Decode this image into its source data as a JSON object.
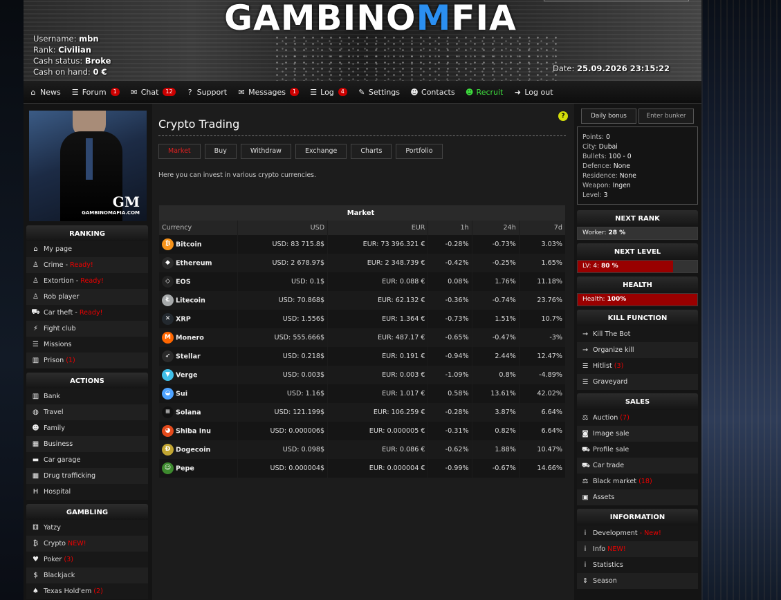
{
  "header": {
    "logo_left": "GAMBINO",
    "logo_m": "M",
    "logo_right": "FIA",
    "user": {
      "username_label": "Username:",
      "username": "mbn",
      "rank_label": "Rank:",
      "rank": "Civilian",
      "cash_status_label": "Cash status:",
      "cash_status": "Broke",
      "cash_label": "Cash on hand:",
      "cash": "0 €"
    },
    "date_label": "Date:",
    "date": "25.09.2026 23:15:22"
  },
  "nav": [
    {
      "icon": "home-icon",
      "glyph": "⌂",
      "label": "News"
    },
    {
      "icon": "list-icon",
      "glyph": "☰",
      "label": "Forum",
      "badge": "1"
    },
    {
      "icon": "chat-icon",
      "glyph": "✉",
      "label": "Chat",
      "badge": "12"
    },
    {
      "icon": "question-icon",
      "glyph": "?",
      "label": "Support"
    },
    {
      "icon": "envelope-icon",
      "glyph": "✉",
      "label": "Messages",
      "badge": "1"
    },
    {
      "icon": "list-icon",
      "glyph": "☰",
      "label": "Log",
      "badge": "4"
    },
    {
      "icon": "wrench-icon",
      "glyph": "✎",
      "label": "Settings"
    },
    {
      "icon": "users-icon",
      "glyph": "☻",
      "label": "Contacts"
    },
    {
      "icon": "user-plus-icon",
      "glyph": "☻",
      "label": "Recruit"
    },
    {
      "icon": "logout-icon",
      "glyph": "➜",
      "label": "Log out"
    }
  ],
  "left": {
    "avatar_text": "GAMBINOMAFIA.COM",
    "avatar_mono": "GM",
    "sections": [
      {
        "title": "RANKING",
        "items": [
          {
            "icon": "home-icon",
            "glyph": "⌂",
            "label": "My page"
          },
          {
            "icon": "person-icon",
            "glyph": "♙",
            "label": "Crime",
            "status": "Ready!"
          },
          {
            "icon": "person-icon",
            "glyph": "♙",
            "label": "Extortion",
            "status": "Ready!"
          },
          {
            "icon": "person-icon",
            "glyph": "♙",
            "label": "Rob player"
          },
          {
            "icon": "car-icon",
            "glyph": "⛟",
            "label": "Car theft",
            "status": "Ready!"
          },
          {
            "icon": "bolt-icon",
            "glyph": "⚡",
            "label": "Fight club"
          },
          {
            "icon": "list-icon",
            "glyph": "☰",
            "label": "Missions"
          },
          {
            "icon": "prison-icon",
            "glyph": "▥",
            "label": "Prison",
            "count": "(1)"
          }
        ]
      },
      {
        "title": "ACTIONS",
        "items": [
          {
            "icon": "bank-icon",
            "glyph": "▥",
            "label": "Bank"
          },
          {
            "icon": "globe-icon",
            "glyph": "◍",
            "label": "Travel"
          },
          {
            "icon": "users-icon",
            "glyph": "☻",
            "label": "Family"
          },
          {
            "icon": "building-icon",
            "glyph": "▦",
            "label": "Business"
          },
          {
            "icon": "garage-icon",
            "glyph": "▬",
            "label": "Car garage"
          },
          {
            "icon": "building-icon",
            "glyph": "▦",
            "label": "Drug trafficking"
          },
          {
            "icon": "hospital-icon",
            "glyph": "H",
            "label": "Hospital"
          }
        ]
      },
      {
        "title": "GAMBLING",
        "items": [
          {
            "icon": "dice-icon",
            "glyph": "⚅",
            "label": "Yatzy"
          },
          {
            "icon": "bitcoin-icon",
            "glyph": "₿",
            "label": "Crypto",
            "status": "NEW!"
          },
          {
            "icon": "heart-icon",
            "glyph": "♥",
            "label": "Poker",
            "count": "(3)"
          },
          {
            "icon": "dollar-icon",
            "glyph": "$",
            "label": "Blackjack"
          },
          {
            "icon": "cowboy-hat-icon",
            "glyph": "♠",
            "label": "Texas Hold'em",
            "count": "(2)"
          }
        ]
      }
    ]
  },
  "main": {
    "title": "Crypto Trading",
    "help": "?",
    "tabs": [
      "Market",
      "Buy",
      "Withdraw",
      "Exchange",
      "Charts",
      "Portfolio"
    ],
    "active_tab": "Market",
    "intro": "Here you can invest in various crypto currencies.",
    "table": {
      "caption": "Market",
      "columns": [
        "Currency",
        "USD",
        "EUR",
        "1h",
        "24h",
        "7d"
      ],
      "rows": [
        {
          "name": "Bitcoin",
          "color": "#f7931a",
          "glyph": "₿",
          "usd": "USD: 83 715.8$",
          "eur": "EUR: 73 396.321 €",
          "h1": "-0.28%",
          "h24": "-0.73%",
          "d7": "3.03%"
        },
        {
          "name": "Ethereum",
          "color": "#2b2b2b",
          "glyph": "◆",
          "usd": "USD: 2 678.97$",
          "eur": "EUR: 2 348.739 €",
          "h1": "-0.42%",
          "h24": "-0.25%",
          "d7": "1.65%"
        },
        {
          "name": "EOS",
          "color": "#222222",
          "glyph": "◇",
          "usd": "USD: 0.1$",
          "eur": "EUR: 0.088 €",
          "h1": "0.08%",
          "h24": "1.76%",
          "d7": "11.18%"
        },
        {
          "name": "Litecoin",
          "color": "#a6a9aa",
          "glyph": "Ł",
          "usd": "USD: 70.868$",
          "eur": "EUR: 62.132 €",
          "h1": "-0.36%",
          "h24": "-0.74%",
          "d7": "23.76%"
        },
        {
          "name": "XRP",
          "color": "#23292f",
          "glyph": "✕",
          "usd": "USD: 1.556$",
          "eur": "EUR: 1.364 €",
          "h1": "-0.73%",
          "h24": "1.51%",
          "d7": "10.7%"
        },
        {
          "name": "Monero",
          "color": "#ff6600",
          "glyph": "M",
          "usd": "USD: 555.666$",
          "eur": "EUR: 487.17 €",
          "h1": "-0.65%",
          "h24": "-0.47%",
          "d7": "-3%"
        },
        {
          "name": "Stellar",
          "color": "#2a2a2a",
          "glyph": "➶",
          "usd": "USD: 0.218$",
          "eur": "EUR: 0.191 €",
          "h1": "-0.94%",
          "h24": "2.44%",
          "d7": "12.47%"
        },
        {
          "name": "Verge",
          "color": "#40bfe8",
          "glyph": "▼",
          "usd": "USD: 0.003$",
          "eur": "EUR: 0.003 €",
          "h1": "-1.09%",
          "h24": "0.8%",
          "d7": "-4.89%"
        },
        {
          "name": "Sui",
          "color": "#4da2ff",
          "glyph": "◒",
          "usd": "USD: 1.16$",
          "eur": "EUR: 1.017 €",
          "h1": "0.58%",
          "h24": "13.61%",
          "d7": "42.02%"
        },
        {
          "name": "Solana",
          "color": "#111111",
          "glyph": "≡",
          "usd": "USD: 121.199$",
          "eur": "EUR: 106.259 €",
          "h1": "-0.28%",
          "h24": "3.87%",
          "d7": "6.64%"
        },
        {
          "name": "Shiba Inu",
          "color": "#e44a1c",
          "glyph": "◕",
          "usd": "USD: 0.000006$",
          "eur": "EUR: 0.000005 €",
          "h1": "-0.31%",
          "h24": "0.82%",
          "d7": "6.64%"
        },
        {
          "name": "Dogecoin",
          "color": "#c2a633",
          "glyph": "Ð",
          "usd": "USD: 0.098$",
          "eur": "EUR: 0.086 €",
          "h1": "-0.62%",
          "h24": "1.88%",
          "d7": "10.47%"
        },
        {
          "name": "Pepe",
          "color": "#3d8a2e",
          "glyph": "☺",
          "usd": "USD: 0.000004$",
          "eur": "EUR: 0.000004 €",
          "h1": "-0.99%",
          "h24": "-0.67%",
          "d7": "14.66%"
        }
      ]
    }
  },
  "right": {
    "daily_bonus": "Daily bonus",
    "enter_bunker": "Enter bunker",
    "stats": [
      {
        "label": "Points:",
        "value": "0"
      },
      {
        "label": "City:",
        "value": "Dubai"
      },
      {
        "label": "Bullets:",
        "value": "100 - 0"
      },
      {
        "label": "Defence:",
        "value": "None"
      },
      {
        "label": "Residence:",
        "value": "None"
      },
      {
        "label": "Weapon:",
        "value": "Ingen"
      },
      {
        "label": "Level:",
        "value": "3"
      }
    ],
    "next_rank": {
      "title": "NEXT RANK",
      "label": "Worker:",
      "value": "28 %",
      "fraction": 0.28
    },
    "next_level": {
      "title": "NEXT LEVEL",
      "label": "LV: 4:",
      "value": "80 %",
      "fraction": 0.8
    },
    "health": {
      "title": "HEALTH",
      "label": "Health:",
      "value": "100%",
      "fraction": 1.0
    },
    "sections": [
      {
        "title": "KILL FUNCTION",
        "items": [
          {
            "icon": "arrow-right-icon",
            "glyph": "→",
            "label": "Kill The Bot"
          },
          {
            "icon": "arrow-right-icon",
            "glyph": "→",
            "label": "Organize kill"
          },
          {
            "icon": "list-icon",
            "glyph": "☰",
            "label": "Hitlist",
            "count": "(3)"
          },
          {
            "icon": "list-icon",
            "glyph": "☰",
            "label": "Graveyard"
          }
        ]
      },
      {
        "title": "SALES",
        "items": [
          {
            "icon": "scale-icon",
            "glyph": "⚖",
            "label": "Auction",
            "count": "(7)"
          },
          {
            "icon": "camera-icon",
            "glyph": "◙",
            "label": "Image sale"
          },
          {
            "icon": "cart-icon",
            "glyph": "⛟",
            "label": "Profile sale"
          },
          {
            "icon": "car-icon",
            "glyph": "⛟",
            "label": "Car trade"
          },
          {
            "icon": "scale-icon",
            "glyph": "⚖",
            "label": "Black market",
            "count": "(18)"
          },
          {
            "icon": "box-icon",
            "glyph": "▣",
            "label": "Assets"
          }
        ]
      },
      {
        "title": "INFORMATION",
        "items": [
          {
            "icon": "info-icon",
            "glyph": "i",
            "label": "Development",
            "status": "- New!"
          },
          {
            "icon": "info-icon",
            "glyph": "i",
            "label": "Info",
            "status": "NEW!"
          },
          {
            "icon": "info-icon",
            "glyph": "i",
            "label": "Statistics"
          },
          {
            "icon": "sort-icon",
            "glyph": "⇕",
            "label": "Season"
          }
        ]
      }
    ]
  },
  "colors": {
    "negative": "#ff4040",
    "positive": "#44dd44",
    "accent": "#2b8ff0",
    "ready": "#e00000",
    "recruit": "#3ee03e",
    "help": "#d4de0a"
  }
}
